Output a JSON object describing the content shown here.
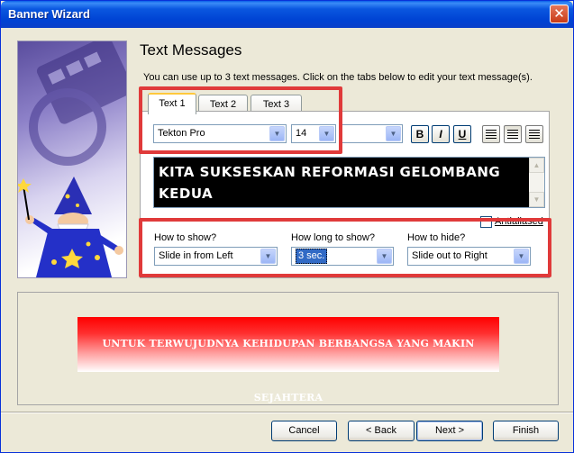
{
  "window": {
    "title": "Banner Wizard",
    "close": "✕"
  },
  "page": {
    "heading": "Text Messages",
    "subtitle": "You can use up to 3 text messages. Click on the tabs below to edit your text message(s)."
  },
  "tabs": [
    {
      "label": "Text 1",
      "active": true
    },
    {
      "label": "Text 2",
      "active": false
    },
    {
      "label": "Text 3",
      "active": false
    }
  ],
  "font": {
    "family": "Tekton Pro",
    "size": "14",
    "color": ""
  },
  "format": {
    "bold": "B",
    "italic": "I",
    "underline": "U"
  },
  "message": {
    "text": "KITA SUKSESKAN REFORMASI GELOMBANG KEDUA"
  },
  "antialiased": {
    "label": "Antialiased",
    "checked": false
  },
  "animation": {
    "show_label": "How to show?",
    "show_value": "Slide in from Left",
    "duration_label": "How long to show?",
    "duration_value": "3 sec.",
    "hide_label": "How to hide?",
    "hide_value": "Slide out to Right"
  },
  "preview": {
    "banner_text": "UNTUK TERWUJUDNYA KEHIDUPAN BERBANGSA YANG MAKIN SEJAHTERA"
  },
  "buttons": {
    "cancel": "Cancel",
    "back": "< Back",
    "next": "Next >",
    "finish": "Finish"
  },
  "colors": {
    "highlight": "#e03a3a",
    "banner_top": "#ff0000",
    "titlebar": "#0043d4"
  },
  "icons": [
    "close-icon",
    "dropdown-arrow-icon",
    "bold-icon",
    "italic-icon",
    "underline-icon",
    "align-left-icon",
    "align-center-icon",
    "align-right-icon",
    "wizard-illustration"
  ]
}
